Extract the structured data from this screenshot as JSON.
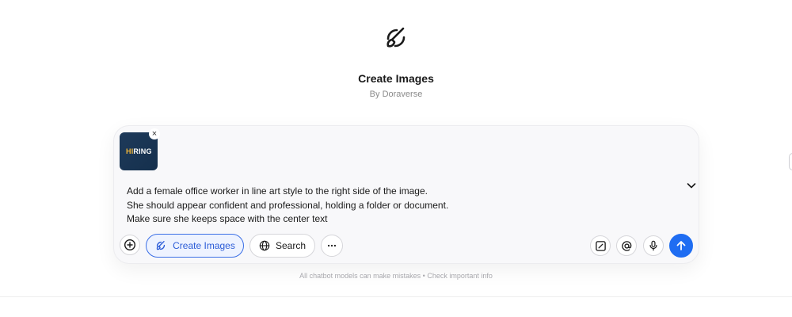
{
  "header": {
    "logo_icon": "paint-brush-logo-icon",
    "title": "Create Images",
    "subtitle": "By Doraverse"
  },
  "composer": {
    "attachment": {
      "thumbnail_text_prefix": "HI",
      "thumbnail_text_suffix": "RING",
      "remove_icon": "close-icon"
    },
    "prompt_lines": [
      "Add a female office worker in line art style to the right side of the image.",
      "She should appear confident and professional, holding a folder or document.",
      "Make sure she keeps space with the center text"
    ],
    "toolbar": {
      "add_icon": "plus-circle-icon",
      "create_images_label": "Create Images",
      "search_label": "Search",
      "more_icon": "ellipsis-icon",
      "canvas_icon": "edit-square-icon",
      "mention_icon": "at-sign-icon",
      "mic_icon": "microphone-icon",
      "send_icon": "arrow-up-icon"
    },
    "collapse_icon": "chevron-down-icon"
  },
  "footer": {
    "disclaimer": "All chatbot models can make mistakes • Check important info"
  },
  "colors": {
    "accent": "#1f6df2",
    "create_button_bg": "#eef3ff",
    "create_button_border": "#3b6fe6"
  }
}
